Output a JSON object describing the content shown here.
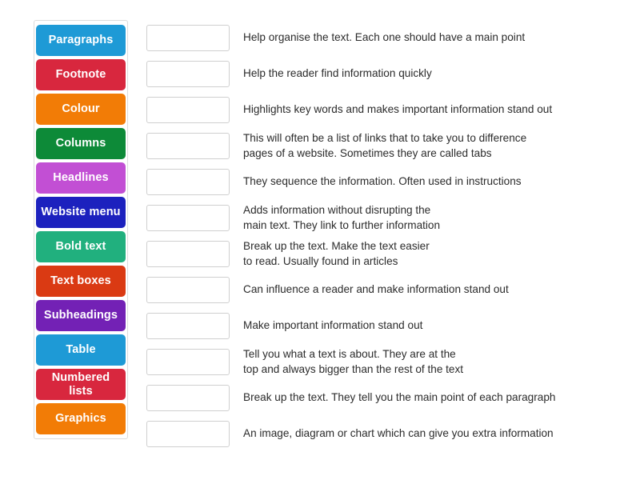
{
  "activity": {
    "type": "match-up-drag-and-drop",
    "tiles_panel_label": "answer-tiles",
    "rows_panel_label": "definition-rows"
  },
  "tiles": [
    {
      "label": "Paragraphs",
      "color": "#1e9ad6",
      "text_color": "#ffffff"
    },
    {
      "label": "Footnote",
      "color": "#d8273e",
      "text_color": "#ffffff"
    },
    {
      "label": "Colour",
      "color": "#f27c06",
      "text_color": "#ffffff"
    },
    {
      "label": "Columns",
      "color": "#0d8a38",
      "text_color": "#ffffff"
    },
    {
      "label": "Headlines",
      "color": "#c24fd4",
      "text_color": "#ffffff"
    },
    {
      "label": "Website menu",
      "color": "#1c21be",
      "text_color": "#ffffff"
    },
    {
      "label": "Bold text",
      "color": "#21b07e",
      "text_color": "#ffffff"
    },
    {
      "label": "Text boxes",
      "color": "#da3a13",
      "text_color": "#ffffff"
    },
    {
      "label": "Subheadings",
      "color": "#7321b5",
      "text_color": "#ffffff"
    },
    {
      "label": "Table",
      "color": "#1e9ad6",
      "text_color": "#ffffff"
    },
    {
      "label": "Numbered\nlists",
      "color": "#d8273e",
      "text_color": "#ffffff"
    },
    {
      "label": "Graphics",
      "color": "#f27c06",
      "text_color": "#ffffff"
    }
  ],
  "rows": [
    {
      "dropzone_value": "",
      "definition": "Help organise the text. Each one should have a main point"
    },
    {
      "dropzone_value": "",
      "definition": "Help the reader find information  quickly"
    },
    {
      "dropzone_value": "",
      "definition": "Highlights  key words and makes important  information  stand out"
    },
    {
      "dropzone_value": "",
      "definition": "This will often be a list of links that to take you to difference\npages of a website. Sometimes they are called tabs"
    },
    {
      "dropzone_value": "",
      "definition": "They sequence the information.  Often used in instructions"
    },
    {
      "dropzone_value": "",
      "definition": "Adds information  without  disrupting  the\nmain text. They link to further information"
    },
    {
      "dropzone_value": "",
      "definition": "Break up the text. Make the text easier\nto read. Usually found in articles"
    },
    {
      "dropzone_value": "",
      "definition": "Can influence  a reader and make information  stand out"
    },
    {
      "dropzone_value": "",
      "definition": "Make important  information  stand out"
    },
    {
      "dropzone_value": "",
      "definition": "Tell you what a text is about. They are at the\ntop and always bigger than the rest of the text"
    },
    {
      "dropzone_value": "",
      "definition": "Break up the text. They tell you the main point of each paragraph"
    },
    {
      "dropzone_value": "",
      "definition": "An image, diagram  or chart which can give you extra information"
    }
  ],
  "colors": {
    "page_background": "#ffffff",
    "panel_border": "#dcdcdc",
    "dropzone_border": "#cfcfcf",
    "definition_text": "#2b2b2b"
  }
}
